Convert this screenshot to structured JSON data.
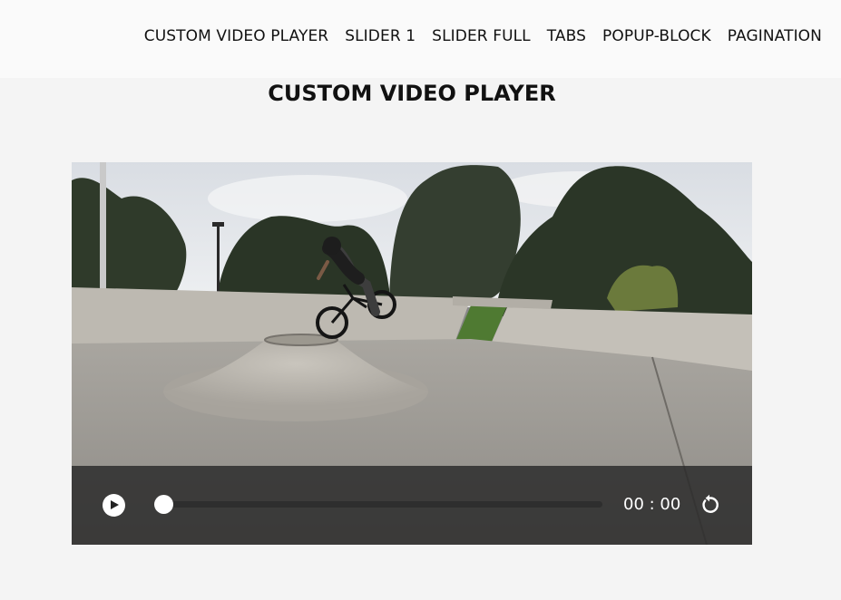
{
  "nav": {
    "items": [
      {
        "label": "CUSTOM VIDEO PLAYER"
      },
      {
        "label": "SLIDER 1"
      },
      {
        "label": "SLIDER FULL"
      },
      {
        "label": "TABS"
      },
      {
        "label": "POPUP-BLOCK"
      },
      {
        "label": "PAGINATION"
      }
    ]
  },
  "page": {
    "title": "CUSTOM VIDEO PLAYER"
  },
  "player": {
    "time": "00 : 00",
    "progress": 0,
    "play_icon": "play-icon",
    "replay_icon": "replay-icon"
  },
  "colors": {
    "background": "#f4f4f4",
    "header": "#fafafa",
    "controls_bar": "#282828",
    "accent": "#ffffff"
  }
}
